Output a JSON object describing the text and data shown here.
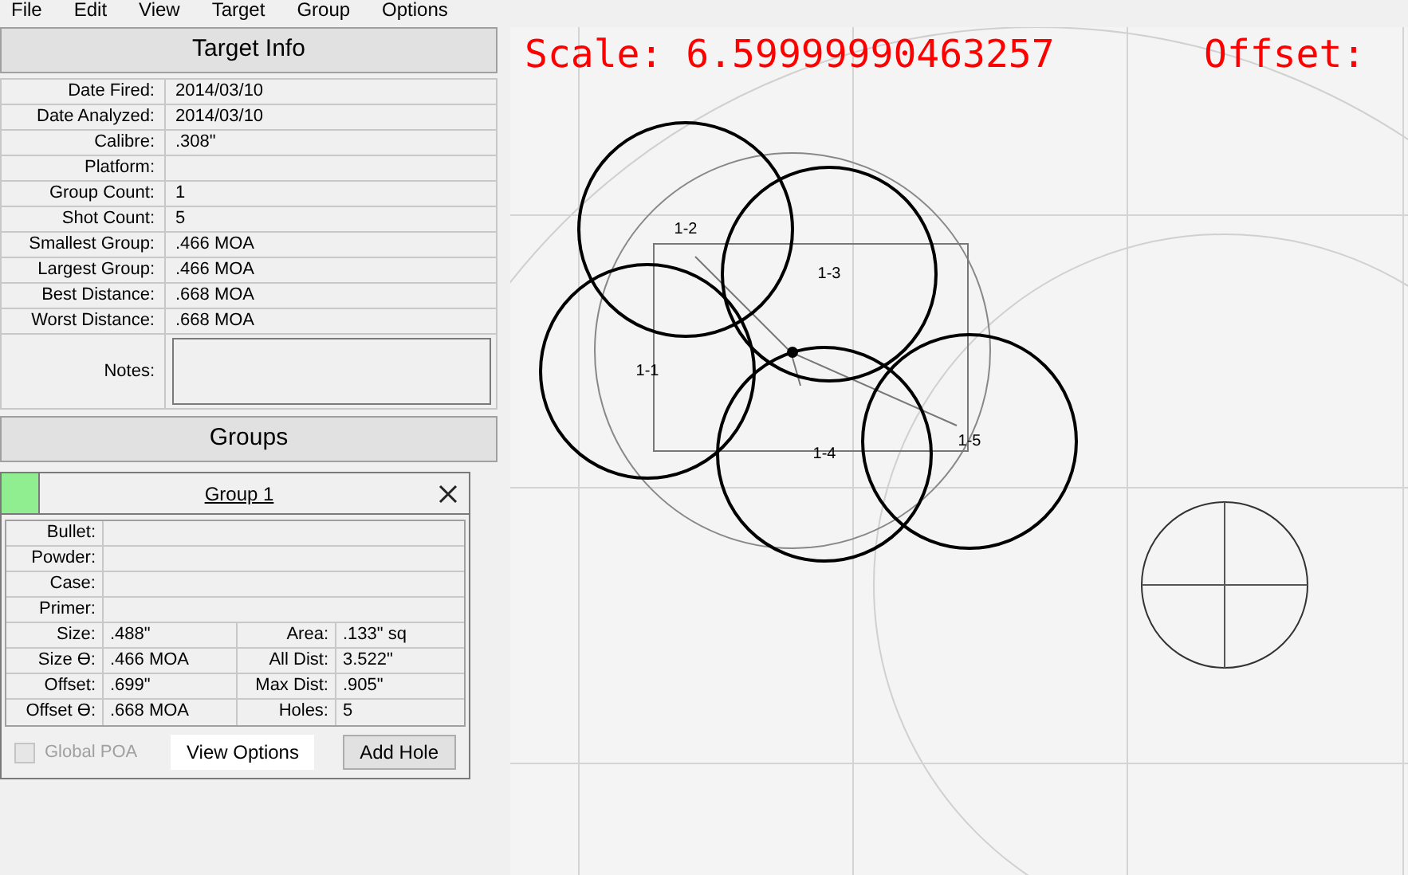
{
  "menu": [
    "File",
    "Edit",
    "View",
    "Target",
    "Group",
    "Options"
  ],
  "target_info": {
    "title": "Target Info",
    "fields": [
      {
        "label": "Date Fired:",
        "value": "2014/03/10"
      },
      {
        "label": "Date Analyzed:",
        "value": "2014/03/10"
      },
      {
        "label": "Calibre:",
        "value": ".308\""
      },
      {
        "label": "Platform:"
      },
      {
        "label": "Group Count:",
        "value": "1"
      },
      {
        "label": "Shot Count:",
        "value": "5"
      },
      {
        "label": "Smallest Group:",
        "value": ".466 MOA"
      },
      {
        "label": "Largest Group:",
        "value": ".466 MOA"
      },
      {
        "label": "Best Distance:",
        "value": ".668 MOA"
      },
      {
        "label": "Worst Distance:",
        "value": ".668 MOA"
      }
    ],
    "notes_label": "Notes:"
  },
  "groups": {
    "title": "Groups",
    "items": [
      {
        "name": "Group 1",
        "color": "#90ee90",
        "load": [
          {
            "label": "Bullet:"
          },
          {
            "label": "Powder:"
          },
          {
            "label": "Case:"
          },
          {
            "label": "Primer:"
          }
        ],
        "stats": [
          {
            "label": "Size:",
            "value": ".488\"",
            "label2": "Area:",
            "value2": ".133\" sq"
          },
          {
            "label": "Size ϴ:",
            "value": ".466 MOA",
            "label2": "All Dist:",
            "value2": "3.522\""
          },
          {
            "label": "Offset:",
            "value": ".699\"",
            "label2": "Max Dist:",
            "value2": ".905\""
          },
          {
            "label": "Offset ϴ:",
            "value": ".668 MOA",
            "label2": "Holes:",
            "value2": "5"
          }
        ],
        "global_poa": {
          "label": "Global POA",
          "checked": false,
          "disabled": true
        },
        "view_options": "View Options",
        "add_hole": "Add Hole"
      }
    ]
  },
  "canvas": {
    "scale_text": "Scale: 6.59999990463257",
    "offset_text": "Offset:",
    "holes": [
      {
        "label": "1-1"
      },
      {
        "label": "1-2"
      },
      {
        "label": "1-3"
      },
      {
        "label": "1-4"
      },
      {
        "label": "1-5"
      }
    ]
  }
}
